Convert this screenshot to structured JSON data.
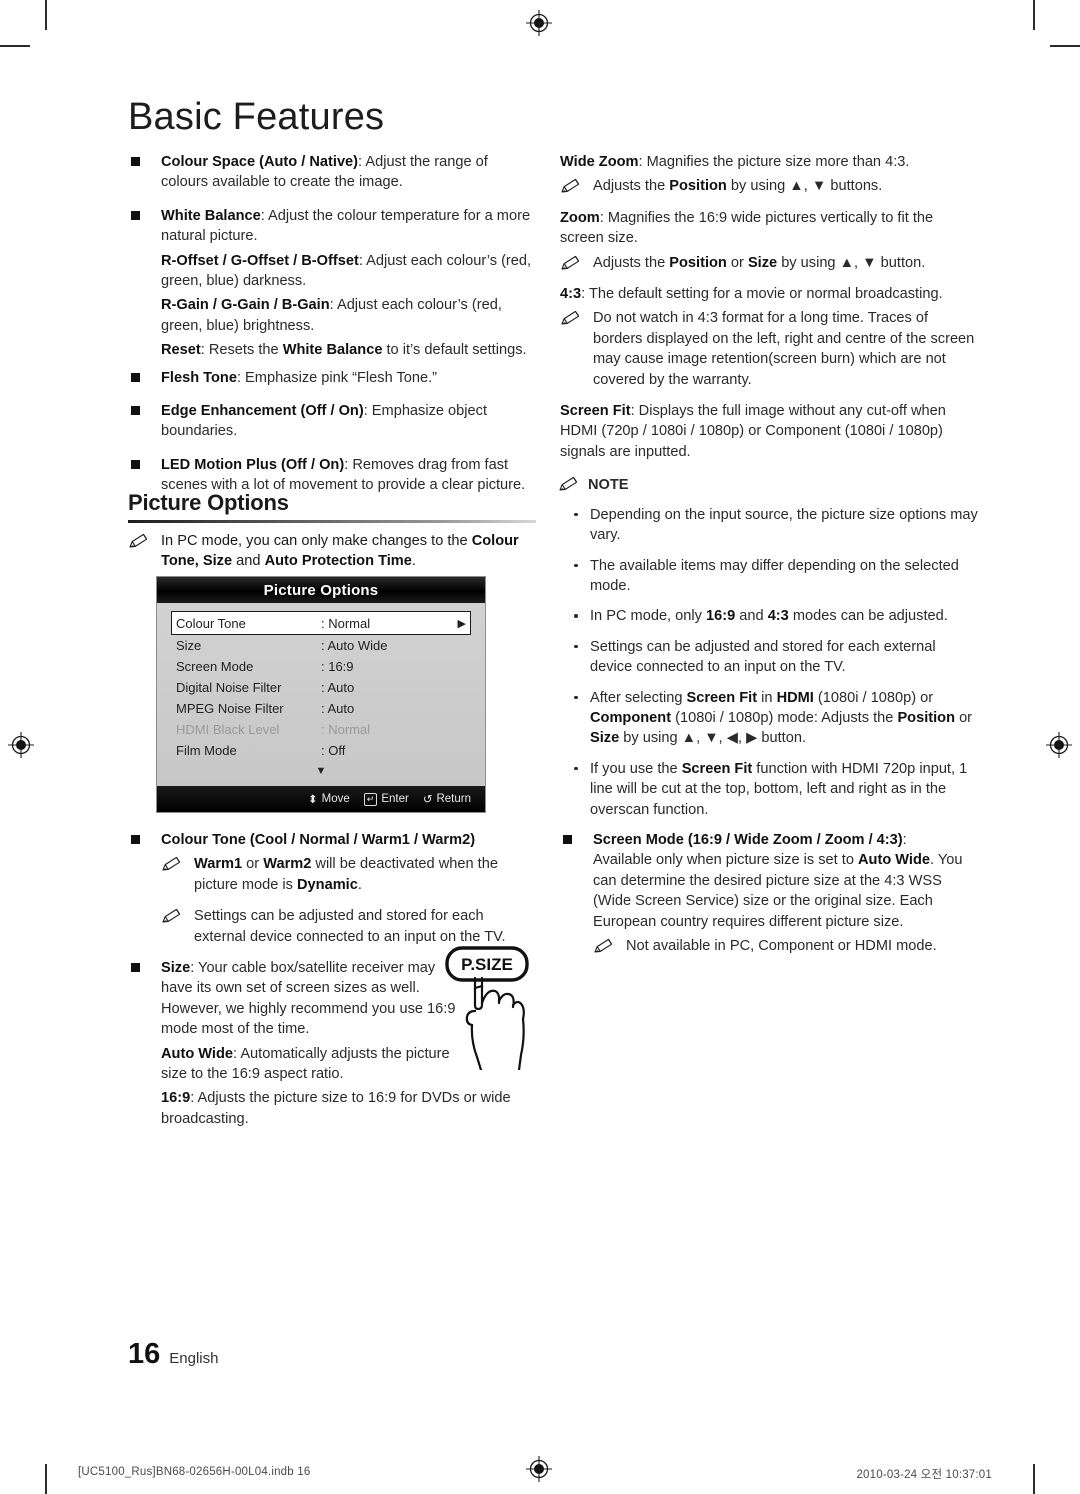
{
  "chapter": {
    "title": "Basic Features"
  },
  "left_column": {
    "items": [
      {
        "type": "square",
        "bold": "Colour Space (Auto / Native)",
        "rest": ": Adjust the range of colours available to create the image."
      },
      {
        "type": "square",
        "bold": "White Balance",
        "rest": ": Adjust the colour temperature for a more natural picture."
      },
      {
        "type": "sub",
        "bold": "R-Offset / G-Offset / B-Offset",
        "rest": ": Adjust each colour’s (red, green, blue) darkness."
      },
      {
        "type": "sub",
        "bold": "R-Gain / G-Gain / B-Gain",
        "rest": ": Adjust each colour’s (red, green, blue) brightness."
      },
      {
        "type": "sub_reset",
        "bold": "Reset",
        "mid": ": Resets the ",
        "bold2": "White Balance",
        "rest": " to it’s default settings."
      },
      {
        "type": "square",
        "bold": "Flesh Tone",
        "rest": ": Emphasize pink “Flesh Tone.”"
      },
      {
        "type": "square",
        "bold": "Edge Enhancement (Off / On)",
        "rest": ": Emphasize object boundaries."
      },
      {
        "type": "square",
        "bold": "LED Motion Plus (Off / On)",
        "rest": ": Removes drag from fast scenes with a lot of movement to provide a clear picture."
      }
    ]
  },
  "section": {
    "heading": "Picture Options",
    "intro_a": "In PC mode, you can only make changes to the ",
    "intro_b": "Colour Tone, Size",
    "intro_c": " and ",
    "intro_d": "Auto Protection Time",
    "intro_e": "."
  },
  "osd": {
    "title": "Picture Options",
    "rows": [
      {
        "label": "Colour Tone",
        "value": ": Normal",
        "selected": true,
        "dim": false,
        "arrow": "▶"
      },
      {
        "label": "Size",
        "value": ": Auto Wide",
        "selected": false,
        "dim": false,
        "arrow": ""
      },
      {
        "label": "Screen Mode",
        "value": ": 16:9",
        "selected": false,
        "dim": false,
        "arrow": ""
      },
      {
        "label": "Digital Noise Filter",
        "value": ": Auto",
        "selected": false,
        "dim": false,
        "arrow": ""
      },
      {
        "label": "MPEG Noise Filter",
        "value": ": Auto",
        "selected": false,
        "dim": false,
        "arrow": ""
      },
      {
        "label": "HDMI Black Level",
        "value": ": Normal",
        "selected": false,
        "dim": true,
        "arrow": ""
      },
      {
        "label": "Film Mode",
        "value": ": Off",
        "selected": false,
        "dim": false,
        "arrow": ""
      }
    ],
    "scroll_down_glyph": "▼",
    "footer": {
      "move_glyph": "⬍",
      "move_label": "Move",
      "enter_key": "↵",
      "enter_label": "Enter",
      "return_glyph": "↺",
      "return_label": "Return"
    }
  },
  "left_column_after_osd": {
    "colour_tone_title": "Colour Tone (Cool / Normal / Warm1 / Warm2)",
    "note_warm_a": "Warm1",
    "note_warm_b": " or ",
    "note_warm_c": "Warm2",
    "note_warm_d": " will be deactivated when the picture mode is ",
    "note_warm_e": "Dynamic",
    "note_warm_f": ".",
    "note_settings": "Settings can be adjusted and stored for each external device connected to an input on the TV.",
    "size_bold": "Size",
    "size_rest": ": Your cable box/satellite receiver may have its own set of screen sizes as well. However, we highly recommend you use 16:9 mode most of the time.",
    "auto_wide_bold": "Auto Wide",
    "auto_wide_rest": ": Automatically adjusts the picture size to the 16:9 aspect ratio.",
    "ratio_bold": "16:9",
    "ratio_rest": ": Adjusts the picture size to 16:9 for DVDs or wide broadcasting."
  },
  "psize_button": {
    "label": "P.SIZE"
  },
  "right_column": {
    "wide_zoom_bold": "Wide Zoom",
    "wide_zoom_rest": ": Magnifies the picture size more than 4:3.",
    "wide_zoom_note_a": "Adjusts the ",
    "wide_zoom_note_b": "Position",
    "wide_zoom_note_c": " by using ▲, ▼ buttons.",
    "zoom_bold": "Zoom",
    "zoom_rest": ": Magnifies the 16:9 wide pictures vertically to fit the screen size.",
    "zoom_note_a": "Adjusts the ",
    "zoom_note_b": "Position",
    "zoom_note_c": " or ",
    "zoom_note_d": "Size",
    "zoom_note_e": " by using ▲, ▼ button.",
    "four_three_bold": "4:3",
    "four_three_rest": ": The default setting for a movie or normal broadcasting.",
    "four_three_note": "Do not watch in 4:3 format for a long time. Traces of borders displayed on the left, right and centre of the screen may cause image retention(screen burn) which are not covered by the warranty.",
    "screen_fit_bold": "Screen Fit",
    "screen_fit_rest": ": Displays the full image without any cut-off when HDMI (720p / 1080i / 1080p) or Component (1080i / 1080p) signals are inputted.",
    "note_heading": "NOTE",
    "notes": [
      {
        "text": "Depending on the input source, the picture size options may vary."
      },
      {
        "text": "The available items may differ depending on the selected mode."
      },
      {
        "parts": [
          {
            "t": "In PC mode, only ",
            "b": false
          },
          {
            "t": "16:9",
            "b": true
          },
          {
            "t": " and ",
            "b": false
          },
          {
            "t": "4:3",
            "b": true
          },
          {
            "t": " modes can be adjusted.",
            "b": false
          }
        ]
      },
      {
        "text": "Settings can be adjusted and stored for each external device connected to an input on the TV."
      },
      {
        "parts": [
          {
            "t": "After selecting ",
            "b": false
          },
          {
            "t": "Screen Fit",
            "b": true
          },
          {
            "t": " in ",
            "b": false
          },
          {
            "t": "HDMI",
            "b": true
          },
          {
            "t": " (1080i / 1080p) or ",
            "b": false
          },
          {
            "t": "Component",
            "b": true
          },
          {
            "t": " (1080i / 1080p) mode: Adjusts the ",
            "b": false
          },
          {
            "t": "Position",
            "b": true
          },
          {
            "t": " or ",
            "b": false
          },
          {
            "t": "Size",
            "b": true
          },
          {
            "t": " by using ▲, ▼, ◀, ▶ button.",
            "b": false
          }
        ]
      },
      {
        "parts": [
          {
            "t": "If you use the ",
            "b": false
          },
          {
            "t": "Screen Fit",
            "b": true
          },
          {
            "t": " function with HDMI 720p input, 1 line will be cut at the top, bottom, left and right as in the overscan function.",
            "b": false
          }
        ]
      }
    ],
    "screen_mode_bold": "Screen Mode (16:9 / Wide Zoom / Zoom / 4:3)",
    "screen_mode_colon": ":",
    "screen_mode_a": "Available only when picture size is set to ",
    "screen_mode_b": "Auto Wide",
    "screen_mode_c": ". You can determine the desired picture size at the 4:3 WSS (Wide Screen Service) size or the original size. Each European country requires different picture size.",
    "screen_mode_note": "Not available in PC, Component or HDMI mode."
  },
  "footer": {
    "page_number": "16",
    "language": "English",
    "file_name": "[UC5100_Rus]BN68-02656H-00L04.indb   16",
    "timestamp": "2010-03-24   오전 10:37:01"
  }
}
